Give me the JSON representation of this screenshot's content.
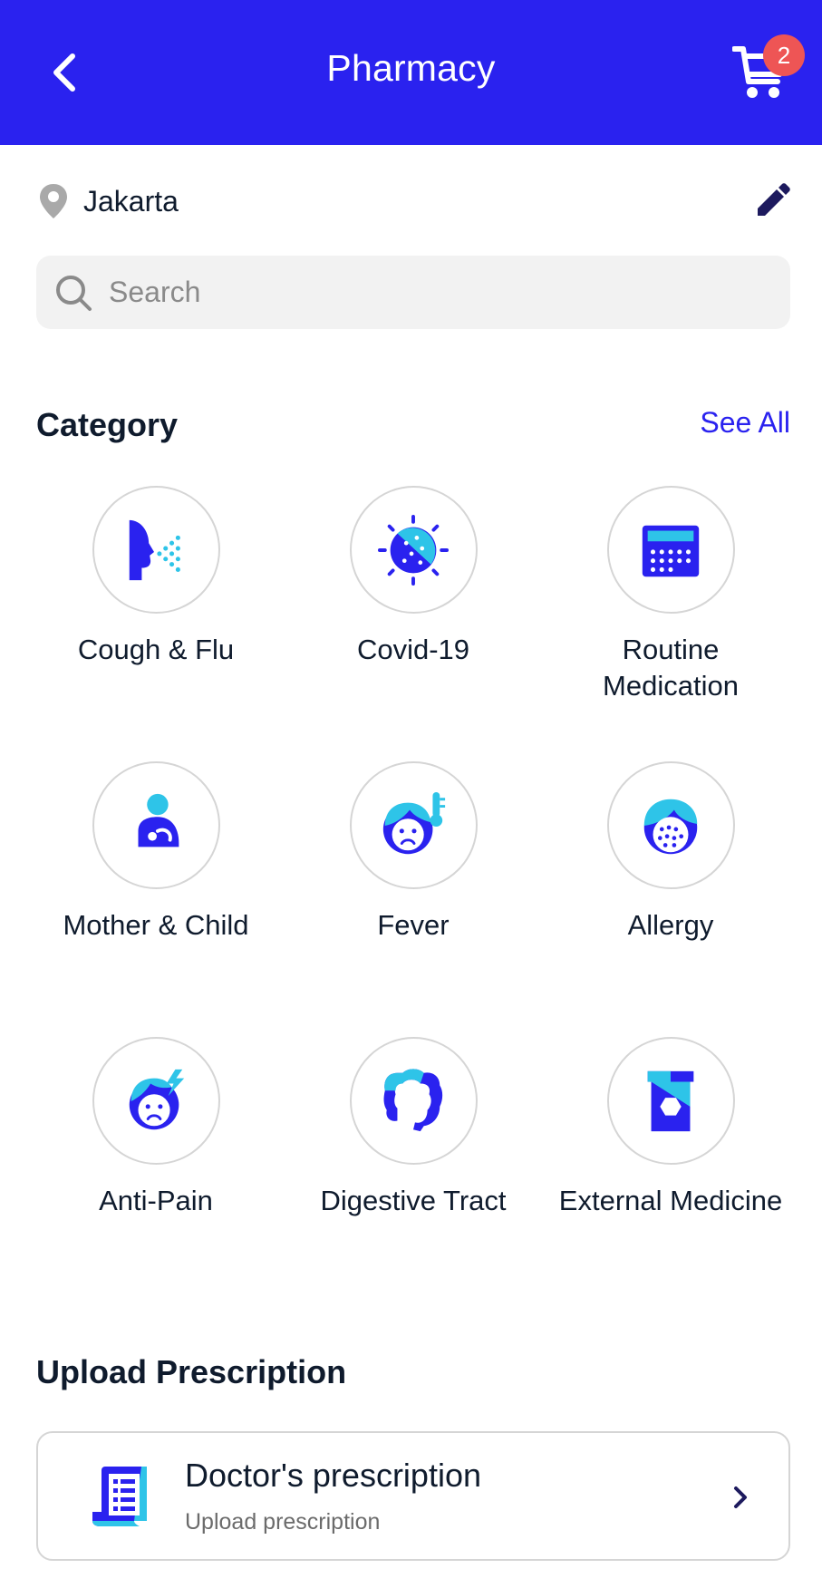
{
  "header": {
    "title": "Pharmacy",
    "cart_count": "2",
    "back_icon": "chevron-left-icon",
    "cart_icon": "cart-icon",
    "background": "#2A22EF"
  },
  "location": {
    "city": "Jakarta",
    "pin_icon": "location-pin-icon",
    "edit_icon": "pencil-icon"
  },
  "search": {
    "placeholder": "Search",
    "value": "",
    "icon": "search-icon"
  },
  "category": {
    "title": "Category",
    "see_all": "See All",
    "items": [
      {
        "label": "Cough & Flu",
        "icon": "cough-flu-icon"
      },
      {
        "label": "Covid-19",
        "icon": "virus-icon"
      },
      {
        "label": "Routine Medication",
        "icon": "calendar-icon"
      },
      {
        "label": "Mother & Child",
        "icon": "mother-child-icon"
      },
      {
        "label": "Fever",
        "icon": "fever-icon"
      },
      {
        "label": "Allergy",
        "icon": "allergy-icon"
      },
      {
        "label": "Anti-Pain",
        "icon": "anti-pain-icon"
      },
      {
        "label": "Digestive Tract",
        "icon": "digestive-tract-icon"
      },
      {
        "label": "External Medicine",
        "icon": "medicine-jar-icon"
      }
    ]
  },
  "upload": {
    "title": "Upload Prescription",
    "card_title": "Doctor's prescription",
    "card_subtitle": "Upload prescription",
    "icon": "prescription-icon",
    "chevron": "chevron-right-icon"
  },
  "colors": {
    "primary": "#2A22EF",
    "accent": "#2EC4E8",
    "badge": "#EE5555"
  }
}
